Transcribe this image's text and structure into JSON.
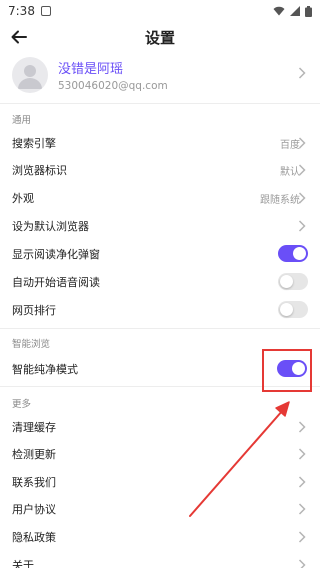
{
  "status_bar": {
    "time": "7:38"
  },
  "header": {
    "title": "设置"
  },
  "profile": {
    "name": "没错是阿瑶",
    "email": "530046020@qq.com"
  },
  "sections": {
    "general": "通用",
    "smart": "智能浏览",
    "more": "更多"
  },
  "rows": {
    "search_engine": {
      "label": "搜索引擎",
      "value": "百度"
    },
    "browser_id": {
      "label": "浏览器标识",
      "value": "默认"
    },
    "appearance": {
      "label": "外观",
      "value": "跟随系统"
    },
    "set_default": {
      "label": "设为默认浏览器"
    },
    "reading_popup": {
      "label": "显示阅读净化弹窗",
      "enabled": true
    },
    "auto_voice": {
      "label": "自动开始语音阅读",
      "enabled": false
    },
    "web_rank": {
      "label": "网页排行",
      "enabled": false
    },
    "pure_mode": {
      "label": "智能纯净模式",
      "enabled": true
    },
    "clear_cache": {
      "label": "清理缓存"
    },
    "check_update": {
      "label": "检测更新"
    },
    "contact": {
      "label": "联系我们"
    },
    "user_agreement": {
      "label": "用户协议"
    },
    "privacy": {
      "label": "隐私政策"
    },
    "about": {
      "label": "关于"
    }
  },
  "colors": {
    "accent": "#6a4ff7",
    "annotation": "#e53935"
  }
}
